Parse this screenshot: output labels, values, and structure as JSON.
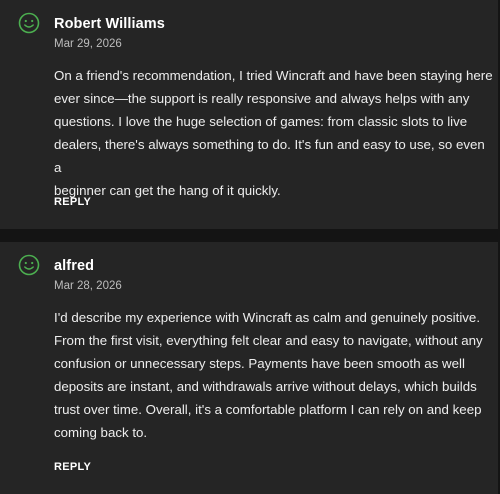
{
  "colors": {
    "accent": "#4caf50",
    "card_background": "#252525",
    "page_background": "#141414"
  },
  "comments": [
    {
      "avatar_icon": "smiley-icon",
      "author": "Robert Williams",
      "date": "Mar 29, 2026",
      "lines": [
        "On a friend's recommendation, I tried Wincraft and have been staying here",
        "ever since—the support is really responsive and always helps with any",
        "questions. I love the huge selection of games: from classic slots to live",
        "dealers, there's always something to do. It's fun and easy to use, so even a",
        "beginner can get the hang of it quickly."
      ],
      "reply_label": "REPLY"
    },
    {
      "avatar_icon": "smiley-icon",
      "author": "alfred",
      "date": "Mar 28, 2026",
      "lines": [
        "I'd describe my experience with Wincraft as calm and genuinely positive.",
        "From the first visit, everything felt clear and easy to navigate, without any",
        "confusion or unnecessary steps. Payments have been smooth as well",
        "deposits are instant, and withdrawals arrive without delays, which builds",
        "trust over time. Overall, it's a comfortable platform I can rely on and keep",
        "coming back to."
      ],
      "reply_label": "REPLY"
    }
  ]
}
